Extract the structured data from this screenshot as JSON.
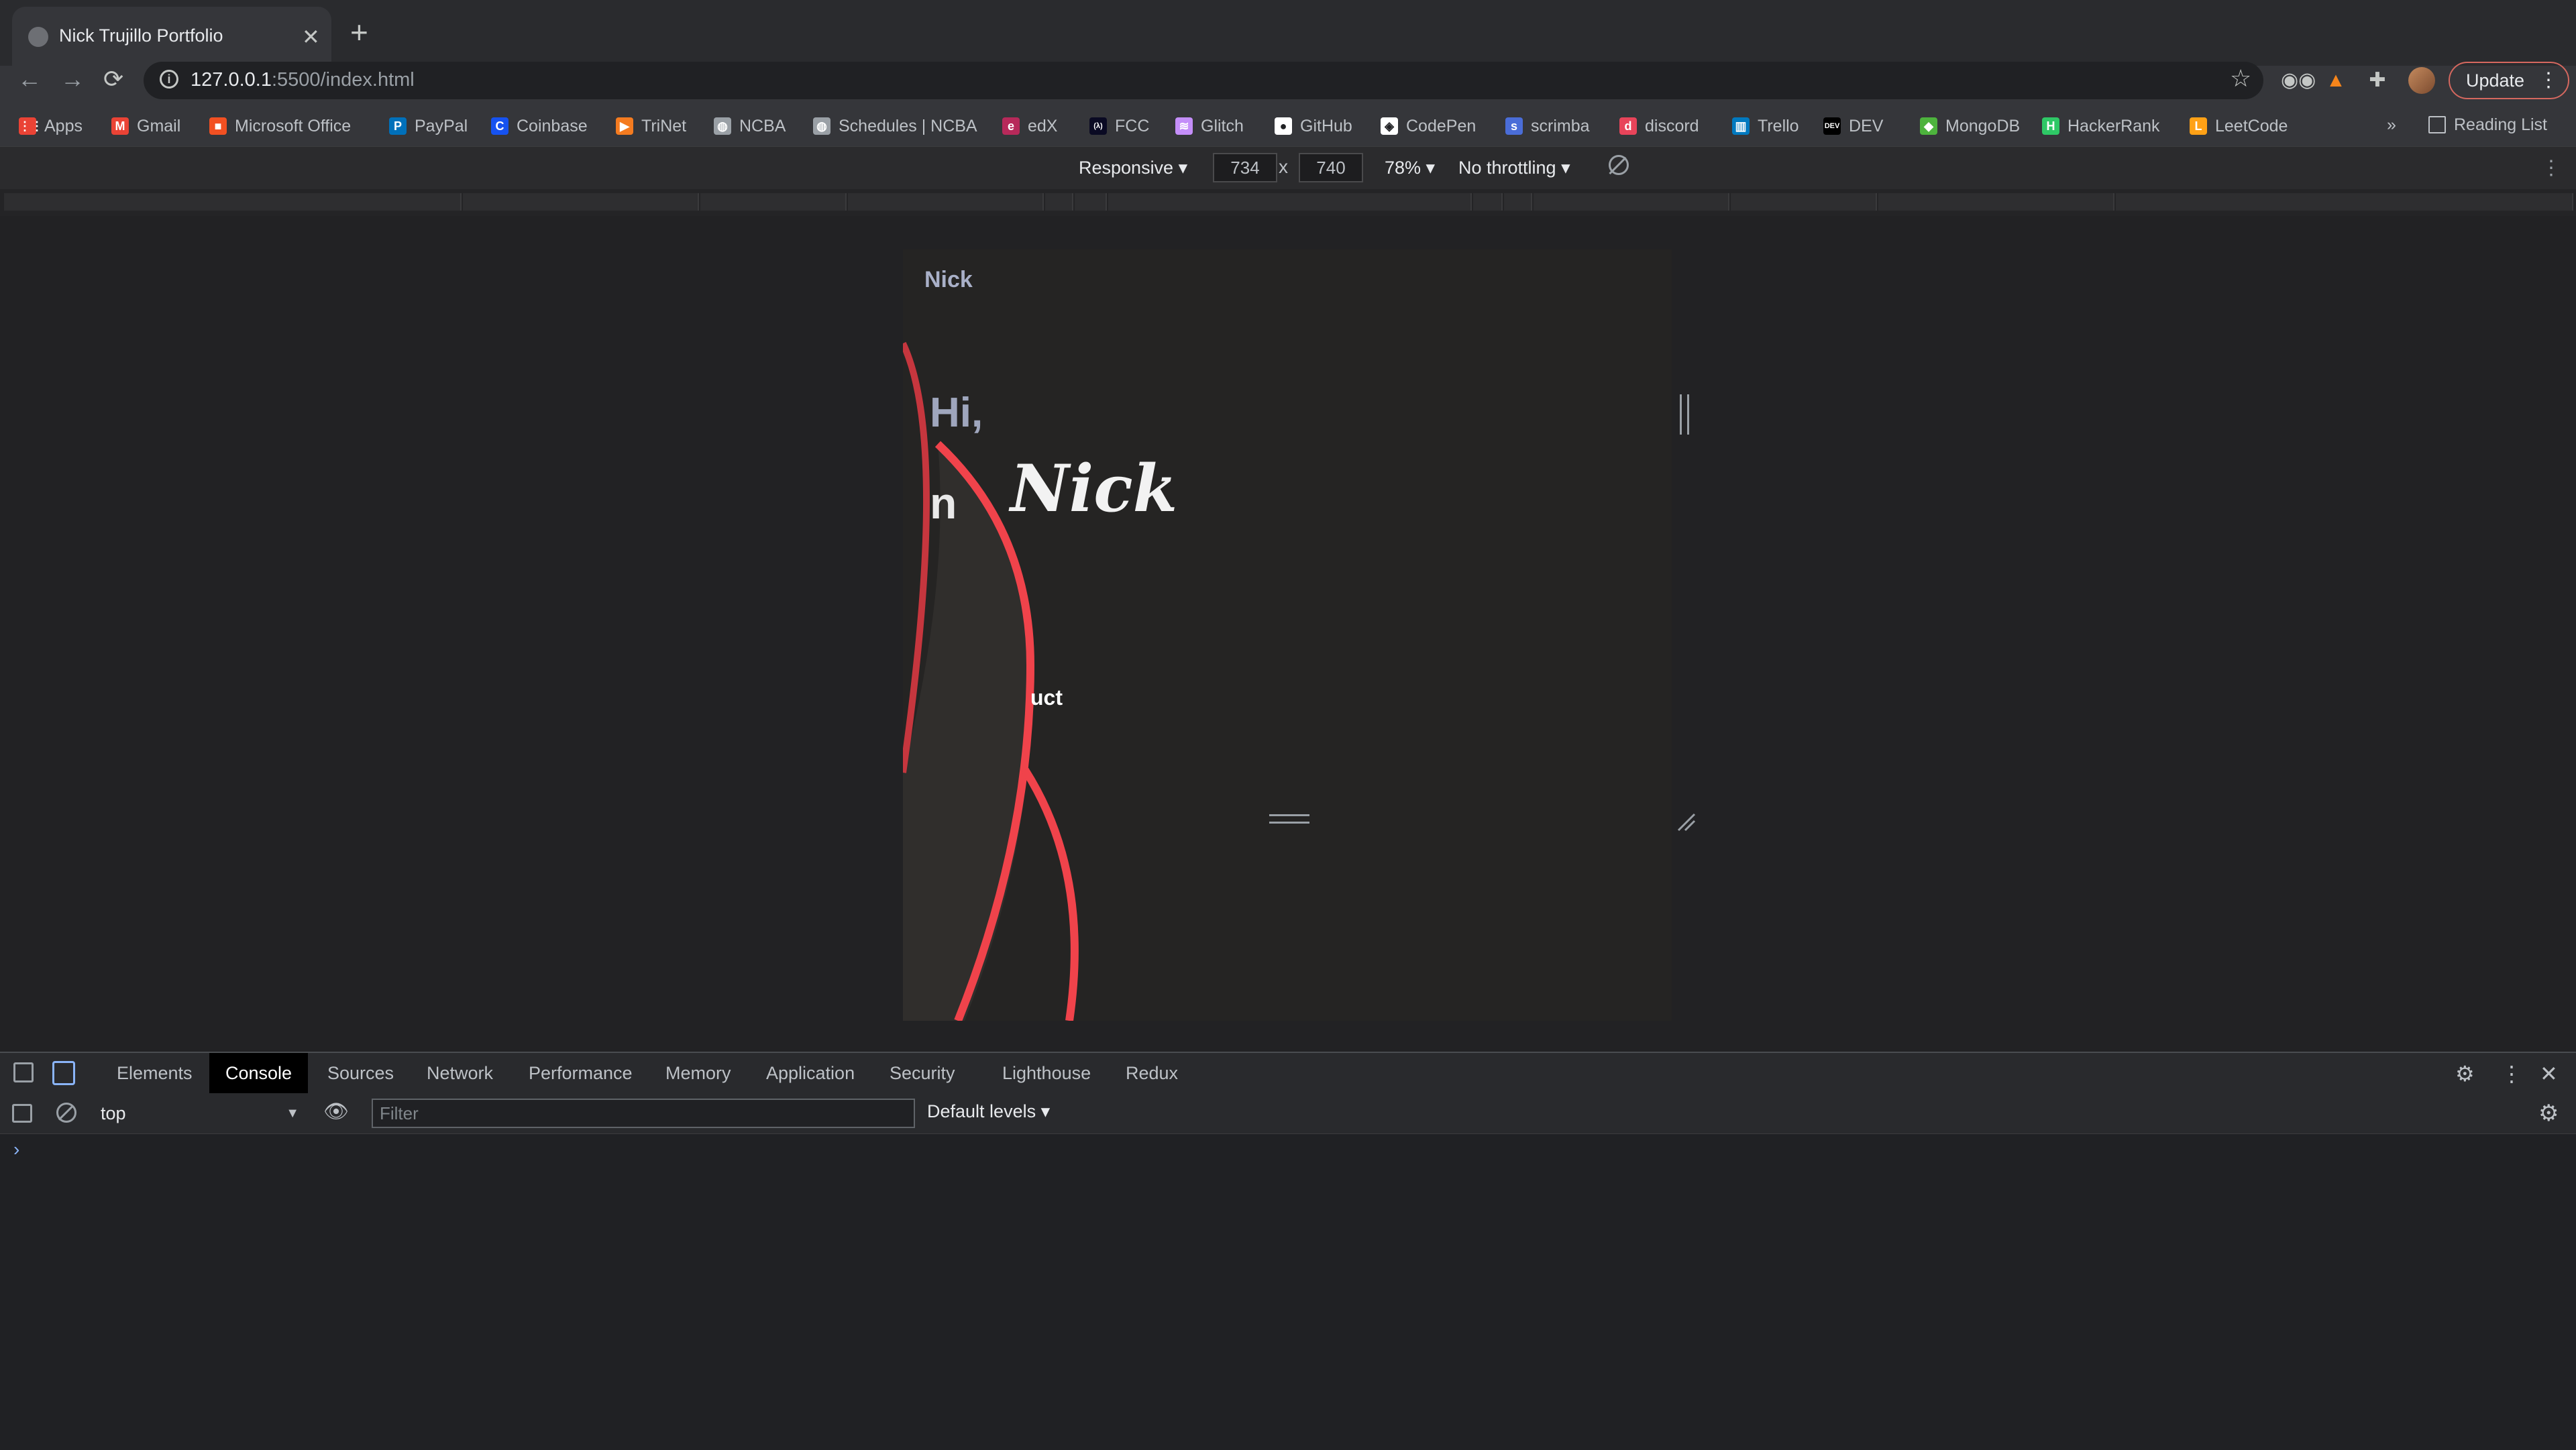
{
  "browser": {
    "tab": {
      "title": "Nick Trujillo Portfolio",
      "close_glyph": "✕"
    },
    "new_tab_glyph": "+",
    "nav": {
      "back_glyph": "←",
      "forward_glyph": "→",
      "reload_glyph": "⟳"
    },
    "omnibox": {
      "url_host": "127.0.0.1",
      "url_rest": ":5500/index.html",
      "info_glyph": "i",
      "star_glyph": "☆"
    },
    "extensions": [
      "binoculars-icon",
      "metamask-icon",
      "puzzle-icon"
    ],
    "update_label": "Update",
    "update_dots": "⋮",
    "bookmarks": [
      {
        "label": "Apps",
        "icon": "apps-grid-icon",
        "color": "#ea4335"
      },
      {
        "label": "Gmail",
        "icon": "gmail-icon",
        "color": "#ea4335"
      },
      {
        "label": "Microsoft Office",
        "icon": "microsoft-icon",
        "color": "#f25022"
      },
      {
        "label": "PayPal",
        "icon": "paypal-icon",
        "color": "#0070ba"
      },
      {
        "label": "Coinbase",
        "icon": "coinbase-icon",
        "color": "#1652f0"
      },
      {
        "label": "TriNet",
        "icon": "trinet-icon",
        "color": "#f47b20"
      },
      {
        "label": "NCBA",
        "icon": "globe-icon",
        "color": "#9aa0a6"
      },
      {
        "label": "Schedules | NCBA",
        "icon": "globe-icon",
        "color": "#9aa0a6"
      },
      {
        "label": "edX",
        "icon": "edx-icon",
        "color": "#b7295a"
      },
      {
        "label": "FCC",
        "icon": "fcc-icon",
        "color": "#0a0a23"
      },
      {
        "label": "Glitch",
        "icon": "glitch-icon",
        "color": "#c48ef9"
      },
      {
        "label": "GitHub",
        "icon": "github-icon",
        "color": "#ffffff"
      },
      {
        "label": "CodePen",
        "icon": "codepen-icon",
        "color": "#ffffff"
      },
      {
        "label": "scrimba",
        "icon": "scrimba-icon",
        "color": "#4a6dd8"
      },
      {
        "label": "discord",
        "icon": "discord-icon",
        "color": "#e8445a"
      },
      {
        "label": "Trello",
        "icon": "trello-icon",
        "color": "#0079bf"
      },
      {
        "label": "DEV",
        "icon": "dev-icon",
        "color": "#000000"
      },
      {
        "label": "MongoDB",
        "icon": "mongodb-icon",
        "color": "#4db33d"
      },
      {
        "label": "HackerRank",
        "icon": "hackerrank-icon",
        "color": "#2ec866"
      },
      {
        "label": "LeetCode",
        "icon": "leetcode-icon",
        "color": "#ffa116"
      }
    ],
    "bookmarks_overflow": "»",
    "reading_list": "Reading List"
  },
  "device_toolbar": {
    "mode": "Responsive ▾",
    "width": "734",
    "height": "740",
    "times": "x",
    "zoom": "78% ▾",
    "throttling": "No throttling ▾",
    "more_glyph": "⋮"
  },
  "site": {
    "brand": "Nick",
    "greeting": "Hi,",
    "im_fragment": "n",
    "name": "Nick",
    "contact_fragment": "uct",
    "accent_color": "#f0434b",
    "bg_color": "#252423"
  },
  "devtools": {
    "tabs": [
      "Elements",
      "Console",
      "Sources",
      "Network",
      "Performance",
      "Memory",
      "Application",
      "Security",
      "Lighthouse",
      "Redux"
    ],
    "active_tab": "Console",
    "gear_glyph": "⚙",
    "more_glyph": "⋮",
    "close_glyph": "✕",
    "console": {
      "context": "top",
      "context_arrow": "▼",
      "filter_placeholder": "Filter",
      "levels": "Default levels ▾",
      "prompt": "›",
      "eye_glyph": "👁"
    }
  }
}
